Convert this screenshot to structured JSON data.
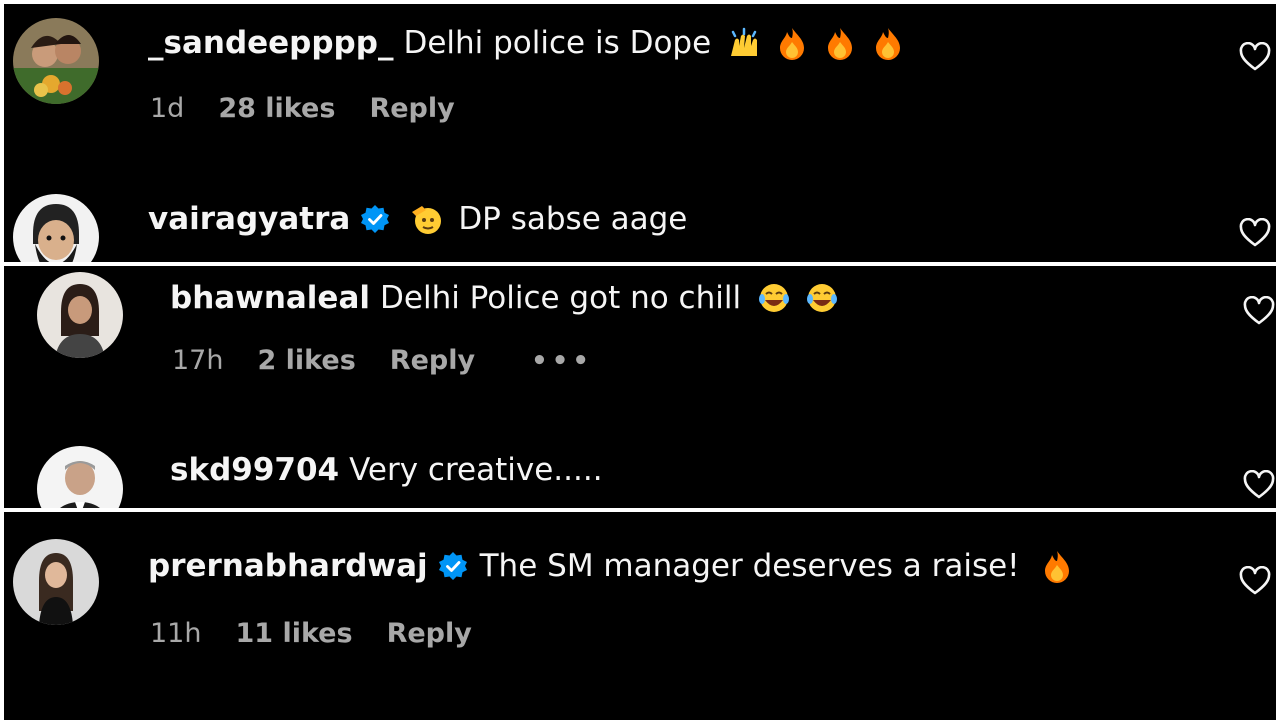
{
  "comments": [
    {
      "username": "_sandeepppp_",
      "text": "Delhi police is Dope",
      "time": "1d",
      "likes": "28 likes",
      "reply": "Reply",
      "verified": false,
      "emojis": [
        "raising-hands",
        "fire",
        "fire",
        "fire"
      ]
    },
    {
      "username": "vairagyatra",
      "text": "DP sabse aage",
      "verified": true,
      "emojis": [
        "saluting-face"
      ]
    },
    {
      "username": "bhawnaleal",
      "text": "Delhi Police got no chill",
      "time": "17h",
      "likes": "2 likes",
      "reply": "Reply",
      "more": "•••",
      "verified": false,
      "emojis": [
        "laughing-tears",
        "laughing-tears"
      ]
    },
    {
      "username": "skd99704",
      "text": "Very creative.....",
      "verified": false,
      "emojis": []
    },
    {
      "username": "prernabhardwaj",
      "text": "The SM manager deserves a raise!",
      "time": "11h",
      "likes": "11 likes",
      "reply": "Reply",
      "verified": true,
      "emojis": [
        "fire"
      ]
    }
  ],
  "colors": {
    "background": "#000000",
    "text": "#f5f5f5",
    "meta": "#a8a8a8",
    "verified": "#0095f6",
    "fire": "#ff7a00"
  },
  "icons": {
    "like": "heart-outline-icon",
    "verified": "verified-badge-icon",
    "more": "more-options-icon"
  }
}
